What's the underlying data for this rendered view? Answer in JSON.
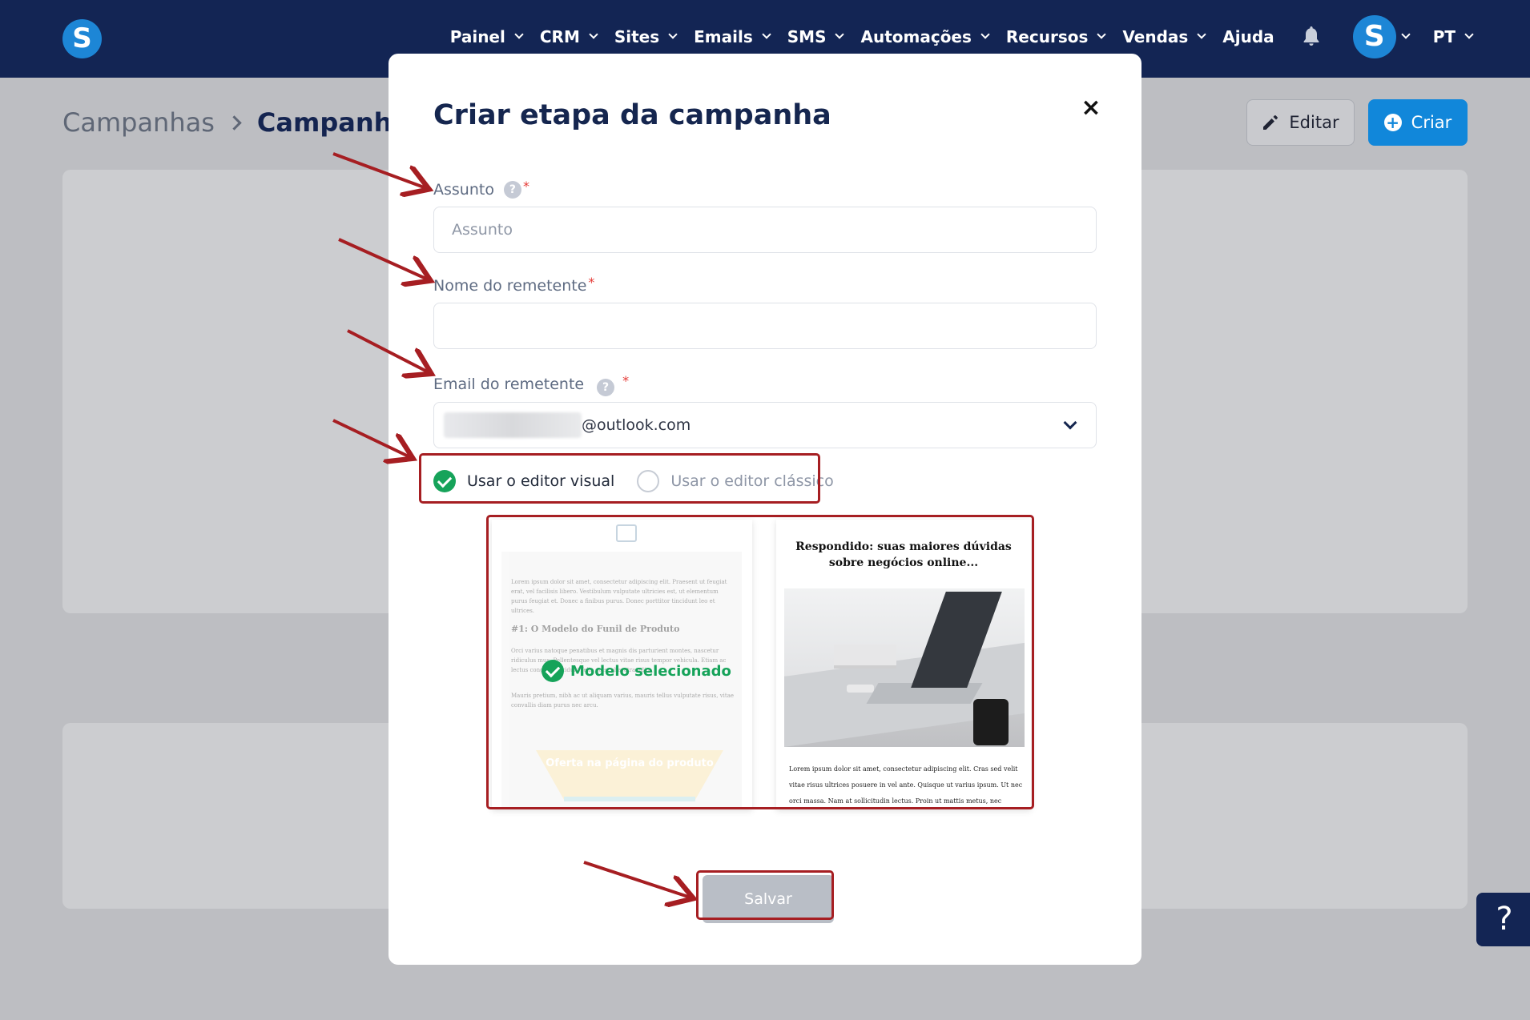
{
  "nav": {
    "logo": "S",
    "items": [
      {
        "label": "Painel",
        "has_menu": true
      },
      {
        "label": "CRM",
        "has_menu": true
      },
      {
        "label": "Sites",
        "has_menu": true
      },
      {
        "label": "Emails",
        "has_menu": true
      },
      {
        "label": "SMS",
        "has_menu": true
      },
      {
        "label": "Automações",
        "has_menu": true
      },
      {
        "label": "Recursos",
        "has_menu": true
      },
      {
        "label": "Vendas",
        "has_menu": true
      },
      {
        "label": "Ajuda",
        "has_menu": false
      }
    ],
    "bell_icon": "bell-icon",
    "avatar_letter": "S",
    "language": "PT"
  },
  "breadcrumb": {
    "parent": "Campanhas",
    "current": "Campanha c"
  },
  "actions": {
    "edit_label": "Editar",
    "create_label": "Criar"
  },
  "help_fab": "?",
  "modal": {
    "title": "Criar etapa da campanha",
    "close": "×",
    "subject": {
      "label": "Assunto",
      "help": "?",
      "required": "*",
      "placeholder": "Assunto",
      "value": ""
    },
    "sender_name": {
      "label": "Nome do remetente",
      "required": "*",
      "value": ""
    },
    "sender_email": {
      "label": "Email do remetente",
      "help": "?",
      "required": "*",
      "value_visible": "@outlook.com"
    },
    "editor_options": [
      {
        "label": "Usar o editor visual",
        "selected": true
      },
      {
        "label": "Usar o editor clássico",
        "selected": false
      }
    ],
    "templates": {
      "selected_badge": "Modelo selecionado",
      "template1": {
        "paragraph1": "Lorem ipsum dolor sit amet, consectetur adipiscing elit. Praesent ut feugiat erat, vel facilisis libero. Vestibulum vulputate ultricies est, ut elementum purus feugiat et. Donec a finibus purus. Donec porttitor tincidunt leo et ultrices.",
        "heading": "#1: O Modelo do Funil de Produto",
        "paragraph2": "Orci varius natoque penatibus et magnis dis parturient montes, nascetur ridiculus mus. Pellentesque vel lectus vitae risus tempor vehicula. Etiam ac lectus congue, tincidunt felis quis, pharetra odio.",
        "paragraph3": "Mauris pretium, nibh ac ut aliquam varius, mauris tellus vulputate risus, vitae convallis diam purus nec arcu.",
        "funnel_label": "Oferta na página do produto"
      },
      "template2": {
        "title": "Respondido: suas maiores dúvidas sobre negócios online...",
        "body": "Lorem ipsum dolor sit amet, consectetur adipiscing elit. Cras sed velit vitae risus ultrices posuere in vel ante. Quisque ut varius ipsum. Ut nec orci massa. Nam at sollicitudin lectus. Proin ut mattis metus, nec semper sapien."
      }
    },
    "save_label": "Salvar"
  },
  "annotation_color": "#a61e22",
  "accent_blue": "#1187da",
  "success_green": "#16a35a"
}
